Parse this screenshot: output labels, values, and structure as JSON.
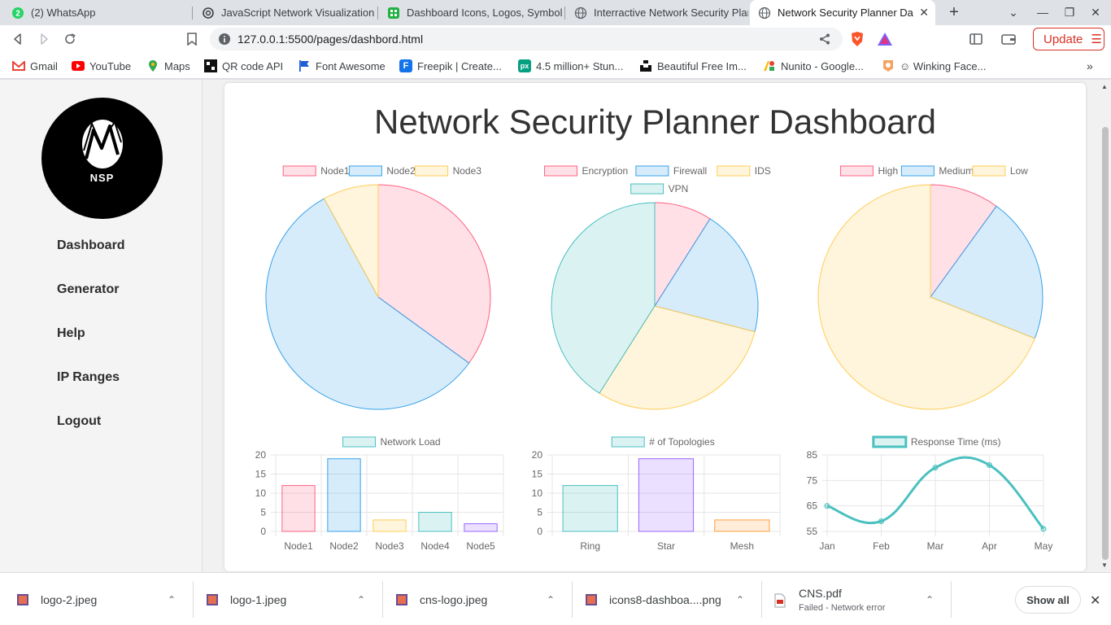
{
  "browser": {
    "tabs": [
      {
        "title": "(2) WhatsApp",
        "badge": "2"
      },
      {
        "title": "JavaScript Network Visualization"
      },
      {
        "title": "Dashboard Icons, Logos, Symbols"
      },
      {
        "title": "Interractive Network Security Planner"
      },
      {
        "title": "Network Security Planner Da"
      }
    ],
    "url": "127.0.0.1:5500/pages/dashbord.html",
    "update_label": "Update",
    "bookmarks": [
      "Gmail",
      "YouTube",
      "Maps",
      "QR code API",
      "Font Awesome",
      "Freepik | Create...",
      "4.5 million+ Stun...",
      "Beautiful Free Im...",
      "Nunito - Google...",
      "☺ Winking Face..."
    ]
  },
  "sidebar": {
    "logo_text": "NSP",
    "nav": [
      {
        "label": "Dashboard"
      },
      {
        "label": "Generator"
      },
      {
        "label": "Help"
      },
      {
        "label": "IP Ranges"
      },
      {
        "label": "Logout"
      }
    ]
  },
  "dashboard": {
    "title": "Network Security Planner Dashboard"
  },
  "chart_data": [
    {
      "type": "pie",
      "labels": [
        "Node1",
        "Node2",
        "Node3"
      ],
      "values": [
        35,
        57,
        8
      ],
      "colors": [
        "#ff6384",
        "#36a2eb",
        "#ffcd56"
      ]
    },
    {
      "type": "pie",
      "labels": [
        "Encryption",
        "Firewall",
        "IDS",
        "VPN"
      ],
      "values": [
        9,
        20,
        30,
        41
      ],
      "colors": [
        "#ff6384",
        "#36a2eb",
        "#ffcd56",
        "#4bc0c0"
      ]
    },
    {
      "type": "pie",
      "labels": [
        "High",
        "Medium",
        "Low"
      ],
      "values": [
        10,
        21,
        69
      ],
      "colors": [
        "#ff6384",
        "#36a2eb",
        "#ffcd56"
      ]
    },
    {
      "type": "bar",
      "series": [
        {
          "name": "Network Load",
          "values": [
            12,
            19,
            3,
            5,
            2
          ]
        }
      ],
      "categories": [
        "Node1",
        "Node2",
        "Node3",
        "Node4",
        "Node5"
      ],
      "colors": [
        "#ff6384",
        "#36a2eb",
        "#ffcd56",
        "#4bc0c0",
        "#9966ff"
      ],
      "ylim": [
        0,
        20
      ],
      "yticks": [
        0,
        5,
        10,
        15,
        20
      ]
    },
    {
      "type": "bar",
      "series": [
        {
          "name": "# of Topologies",
          "values": [
            12,
            19,
            3
          ]
        }
      ],
      "categories": [
        "Ring",
        "Star",
        "Mesh"
      ],
      "colors": [
        "#4bc0c0",
        "#9966ff",
        "#ff9f40"
      ],
      "ylim": [
        0,
        20
      ],
      "yticks": [
        0,
        5,
        10,
        15,
        20
      ]
    },
    {
      "type": "line",
      "series": [
        {
          "name": "Response Time (ms)",
          "values": [
            65,
            59,
            80,
            81,
            56
          ]
        }
      ],
      "categories": [
        "Jan",
        "Feb",
        "Mar",
        "Apr",
        "May"
      ],
      "colors": [
        "#4bc0c0"
      ],
      "ylim": [
        55,
        85
      ],
      "yticks": [
        55,
        65,
        75,
        85
      ]
    }
  ],
  "downloads": {
    "items": [
      {
        "name": "logo-2.jpeg",
        "status": ""
      },
      {
        "name": "logo-1.jpeg",
        "status": ""
      },
      {
        "name": "cns-logo.jpeg",
        "status": ""
      },
      {
        "name": "icons8-dashboa....png",
        "status": ""
      },
      {
        "name": "CNS.pdf",
        "status": "Failed - Network error"
      }
    ],
    "show_all": "Show all"
  }
}
